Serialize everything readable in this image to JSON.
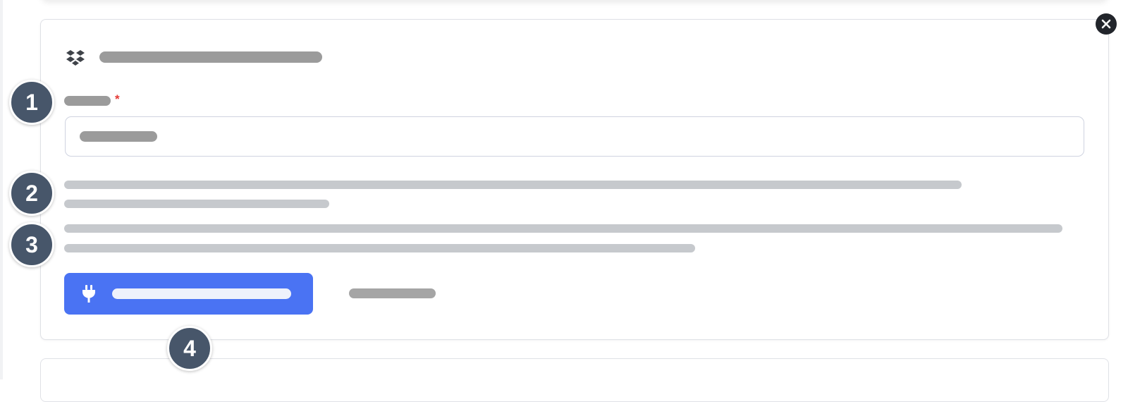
{
  "close": {
    "icon": "close-icon"
  },
  "header": {
    "icon": "dropbox-icon"
  },
  "field": {
    "required_marker": "*"
  },
  "connect_button": {
    "icon": "plug-icon",
    "color": "#4a73f3"
  },
  "markers": [
    "1",
    "2",
    "3",
    "4"
  ]
}
